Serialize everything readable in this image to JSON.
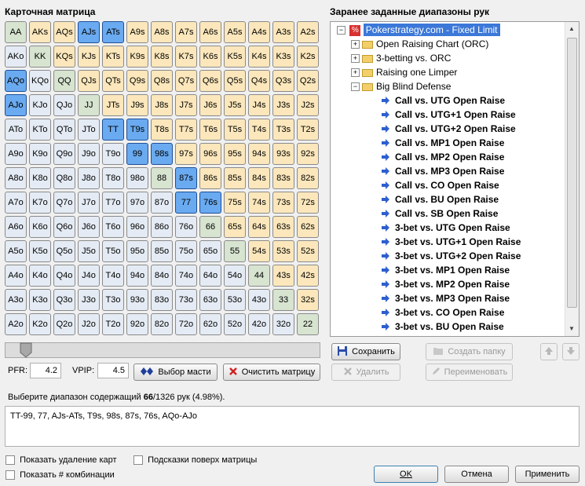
{
  "left_title": "Карточная матрица",
  "right_title": "Заранее заданные диапазоны рук",
  "matrix": {
    "rows": [
      [
        "AA",
        "AKs",
        "AQs",
        "AJs",
        "ATs",
        "A9s",
        "A8s",
        "A7s",
        "A6s",
        "A5s",
        "A4s",
        "A3s",
        "A2s"
      ],
      [
        "AKo",
        "KK",
        "KQs",
        "KJs",
        "KTs",
        "K9s",
        "K8s",
        "K7s",
        "K6s",
        "K5s",
        "K4s",
        "K3s",
        "K2s"
      ],
      [
        "AQo",
        "KQo",
        "QQ",
        "QJs",
        "QTs",
        "Q9s",
        "Q8s",
        "Q7s",
        "Q6s",
        "Q5s",
        "Q4s",
        "Q3s",
        "Q2s"
      ],
      [
        "AJo",
        "KJo",
        "QJo",
        "JJ",
        "JTs",
        "J9s",
        "J8s",
        "J7s",
        "J6s",
        "J5s",
        "J4s",
        "J3s",
        "J2s"
      ],
      [
        "ATo",
        "KTo",
        "QTo",
        "JTo",
        "TT",
        "T9s",
        "T8s",
        "T7s",
        "T6s",
        "T5s",
        "T4s",
        "T3s",
        "T2s"
      ],
      [
        "A9o",
        "K9o",
        "Q9o",
        "J9o",
        "T9o",
        "99",
        "98s",
        "97s",
        "96s",
        "95s",
        "94s",
        "93s",
        "92s"
      ],
      [
        "A8o",
        "K8o",
        "Q8o",
        "J8o",
        "T8o",
        "98o",
        "88",
        "87s",
        "86s",
        "85s",
        "84s",
        "83s",
        "82s"
      ],
      [
        "A7o",
        "K7o",
        "Q7o",
        "J7o",
        "T7o",
        "97o",
        "87o",
        "77",
        "76s",
        "75s",
        "74s",
        "73s",
        "72s"
      ],
      [
        "A6o",
        "K6o",
        "Q6o",
        "J6o",
        "T6o",
        "96o",
        "86o",
        "76o",
        "66",
        "65s",
        "64s",
        "63s",
        "62s"
      ],
      [
        "A5o",
        "K5o",
        "Q5o",
        "J5o",
        "T5o",
        "95o",
        "85o",
        "75o",
        "65o",
        "55",
        "54s",
        "53s",
        "52s"
      ],
      [
        "A4o",
        "K4o",
        "Q4o",
        "J4o",
        "T4o",
        "94o",
        "84o",
        "74o",
        "64o",
        "54o",
        "44",
        "43s",
        "42s"
      ],
      [
        "A3o",
        "K3o",
        "Q3o",
        "J3o",
        "T3o",
        "93o",
        "83o",
        "73o",
        "63o",
        "53o",
        "43o",
        "33",
        "32s"
      ],
      [
        "A2o",
        "K2o",
        "Q2o",
        "J2o",
        "T2o",
        "92o",
        "82o",
        "72o",
        "62o",
        "52o",
        "42o",
        "32o",
        "22"
      ]
    ],
    "selected": [
      "AJs",
      "ATs",
      "AQo",
      "AJo",
      "TT",
      "T9s",
      "99",
      "98s",
      "87s",
      "77",
      "76s"
    ]
  },
  "stats": {
    "pfr_label": "PFR:",
    "pfr_value": "4.2",
    "vpip_label": "VPIP:",
    "vpip_value": "4.5"
  },
  "buttons": {
    "suits": "Выбор масти",
    "clear": "Очистить матрицу",
    "save": "Сохранить",
    "new_folder": "Создать папку",
    "delete": "Удалить",
    "rename": "Переименовать",
    "ok": "OK",
    "cancel": "Отмена",
    "apply": "Применить"
  },
  "tree": {
    "root": "Pokerstrategy.com - Fixed Limit",
    "folders": [
      "Open Raising Chart (ORC)",
      "3-betting vs. ORC",
      "Raising one Limper",
      "Big Blind Defense"
    ],
    "items": [
      "Call vs. UTG Open Raise",
      "Call vs. UTG+1 Open Raise",
      "Call vs. UTG+2 Open Raise",
      "Call vs. MP1 Open Raise",
      "Call vs. MP2 Open Raise",
      "Call vs. MP3 Open Raise",
      "Call vs. CO Open Raise",
      "Call vs. BU Open Raise",
      "Call vs. SB Open Raise",
      "3-bet vs. UTG Open Raise",
      "3-bet vs. UTG+1 Open Raise",
      "3-bet vs. UTG+2 Open Raise",
      "3-bet vs. MP1 Open Raise",
      "3-bet vs. MP2 Open Raise",
      "3-bet vs. MP3 Open Raise",
      "3-bet vs. CO Open Raise",
      "3-bet vs. BU Open Raise"
    ]
  },
  "range_info": {
    "prefix": "Выберите диапазон содержащий ",
    "count": "66",
    "suffix": "/1326 рук (4.98%)."
  },
  "range_text": "TT-99, 77, AJs-ATs, T9s, 98s, 87s, 76s, AQo-AJo",
  "checkboxes": {
    "show_removal": "Показать удаление карт",
    "hints": "Подсказки поверх матрицы",
    "show_combos": "Показать # комбинации"
  },
  "colors": {
    "selected": "#6aaaf0",
    "pair": "#d7e4d0",
    "suited": "#fbe7bb",
    "offsuit": "#e4ebf4"
  }
}
